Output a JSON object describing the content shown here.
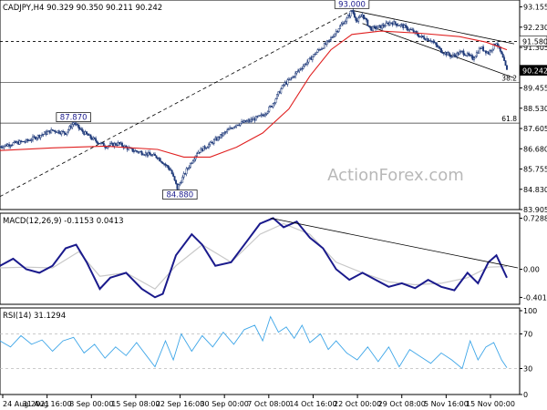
{
  "chart_data": [
    {
      "panel": "price",
      "type": "candlestick",
      "title": "CADJPY,H4  90.329 90.350 90.211 90.242",
      "watermark": "ActionForex.com",
      "last_price": "90.242",
      "y_ticks": [
        "93.155",
        "92.230",
        "91.305",
        "90.380",
        "89.455",
        "88.530",
        "87.605",
        "86.680",
        "85.755",
        "84.830",
        "83.905"
      ],
      "ylim": [
        83.905,
        93.47
      ],
      "x_ticks": [
        "24 Aug 2021",
        "31 Aug 16:00",
        "8 Sep 00:00",
        "15 Sep 08:00",
        "22 Sep 16:00",
        "30 Sep 00:00",
        "7 Oct 08:00",
        "14 Oct 16:00",
        "22 Oct 00:00",
        "29 Oct 08:00",
        "5 Nov 16:00",
        "15 Nov 00:00"
      ],
      "labels": {
        "high": "93.000",
        "left_high": "87.870",
        "low": "84.880",
        "resistance": "91.580"
      },
      "fib_levels": [
        {
          "label": "38.2",
          "value": 89.71
        },
        {
          "label": "61.8",
          "value": 87.85
        }
      ],
      "close_path": [
        [
          0,
          86.78
        ],
        [
          10,
          86.92
        ],
        [
          20,
          87.02
        ],
        [
          30,
          87.28
        ],
        [
          40,
          87.52
        ],
        [
          50,
          87.4
        ],
        [
          56,
          87.87
        ],
        [
          62,
          87.5
        ],
        [
          70,
          87.15
        ],
        [
          80,
          86.8
        ],
        [
          90,
          86.92
        ],
        [
          100,
          86.62
        ],
        [
          110,
          86.48
        ],
        [
          120,
          86.3
        ],
        [
          125,
          86.0
        ],
        [
          130,
          85.7
        ],
        [
          135,
          84.88
        ],
        [
          142,
          85.7
        ],
        [
          150,
          86.5
        ],
        [
          160,
          86.9
        ],
        [
          170,
          87.35
        ],
        [
          180,
          87.8
        ],
        [
          190,
          87.95
        ],
        [
          200,
          88.2
        ],
        [
          207,
          88.65
        ],
        [
          212,
          89.2
        ],
        [
          216,
          89.6
        ],
        [
          222,
          89.9
        ],
        [
          228,
          90.3
        ],
        [
          235,
          90.7
        ],
        [
          242,
          91.15
        ],
        [
          250,
          91.55
        ],
        [
          258,
          92.2
        ],
        [
          264,
          92.6
        ],
        [
          268,
          93.0
        ],
        [
          272,
          92.5
        ],
        [
          276,
          92.8
        ],
        [
          282,
          92.15
        ],
        [
          290,
          92.25
        ],
        [
          298,
          92.45
        ],
        [
          306,
          92.3
        ],
        [
          314,
          92.05
        ],
        [
          320,
          91.8
        ],
        [
          328,
          91.65
        ],
        [
          336,
          91.15
        ],
        [
          344,
          90.9
        ],
        [
          352,
          91.1
        ],
        [
          360,
          90.8
        ],
        [
          366,
          91.3
        ],
        [
          372,
          91.05
        ],
        [
          378,
          91.55
        ],
        [
          383,
          90.8
        ],
        [
          386,
          90.24
        ]
      ],
      "ma_path": [
        [
          0,
          86.6
        ],
        [
          40,
          86.72
        ],
        [
          80,
          86.8
        ],
        [
          120,
          86.65
        ],
        [
          140,
          86.3
        ],
        [
          160,
          86.3
        ],
        [
          180,
          86.75
        ],
        [
          200,
          87.4
        ],
        [
          220,
          88.5
        ],
        [
          236,
          90.0
        ],
        [
          252,
          91.2
        ],
        [
          268,
          91.9
        ],
        [
          290,
          92.05
        ],
        [
          320,
          91.95
        ],
        [
          350,
          91.8
        ],
        [
          370,
          91.55
        ],
        [
          386,
          91.2
        ]
      ],
      "overlays": {
        "rising_trendline": [
          [
            0,
            84.5
          ],
          [
            268,
            93.0
          ]
        ],
        "channel_upper": [
          [
            268,
            93.0
          ],
          [
            386,
            91.55
          ]
        ],
        "channel_lower": [
          [
            276,
            92.4
          ],
          [
            386,
            90.0
          ]
        ],
        "resistance_line": 91.58
      }
    },
    {
      "panel": "macd",
      "type": "line",
      "title": "MACD(12,26,9) -0.1153 0.0413",
      "y_ticks": [
        "0.7288",
        "0.00",
        "-0.4015"
      ],
      "ylim": [
        -0.5,
        0.8
      ],
      "macd_path": [
        [
          0,
          0.05
        ],
        [
          10,
          0.15
        ],
        [
          20,
          0.0
        ],
        [
          30,
          -0.05
        ],
        [
          40,
          0.05
        ],
        [
          50,
          0.3
        ],
        [
          58,
          0.35
        ],
        [
          66,
          0.1
        ],
        [
          76,
          -0.28
        ],
        [
          84,
          -0.12
        ],
        [
          96,
          -0.05
        ],
        [
          108,
          -0.28
        ],
        [
          118,
          -0.4
        ],
        [
          124,
          -0.35
        ],
        [
          134,
          0.2
        ],
        [
          146,
          0.5
        ],
        [
          154,
          0.35
        ],
        [
          164,
          0.05
        ],
        [
          176,
          0.1
        ],
        [
          188,
          0.4
        ],
        [
          198,
          0.65
        ],
        [
          208,
          0.73
        ],
        [
          216,
          0.6
        ],
        [
          226,
          0.68
        ],
        [
          236,
          0.45
        ],
        [
          246,
          0.3
        ],
        [
          256,
          0.0
        ],
        [
          266,
          -0.15
        ],
        [
          276,
          -0.05
        ],
        [
          286,
          -0.15
        ],
        [
          296,
          -0.25
        ],
        [
          306,
          -0.2
        ],
        [
          316,
          -0.27
        ],
        [
          326,
          -0.15
        ],
        [
          336,
          -0.25
        ],
        [
          346,
          -0.3
        ],
        [
          356,
          -0.05
        ],
        [
          364,
          -0.2
        ],
        [
          372,
          0.1
        ],
        [
          378,
          0.2
        ],
        [
          386,
          -0.12
        ]
      ],
      "signal_path": [
        [
          0,
          0.02
        ],
        [
          20,
          0.03
        ],
        [
          40,
          0.02
        ],
        [
          60,
          0.25
        ],
        [
          76,
          -0.1
        ],
        [
          96,
          -0.05
        ],
        [
          118,
          -0.28
        ],
        [
          134,
          0.05
        ],
        [
          154,
          0.35
        ],
        [
          176,
          0.1
        ],
        [
          198,
          0.5
        ],
        [
          216,
          0.65
        ],
        [
          236,
          0.5
        ],
        [
          256,
          0.1
        ],
        [
          276,
          -0.05
        ],
        [
          296,
          -0.18
        ],
        [
          316,
          -0.22
        ],
        [
          336,
          -0.2
        ],
        [
          356,
          -0.12
        ],
        [
          372,
          0.03
        ],
        [
          386,
          0.04
        ]
      ],
      "trendline": [
        [
          206,
          0.73
        ],
        [
          386,
          0.02
        ]
      ]
    },
    {
      "panel": "rsi",
      "type": "line",
      "title": "RSI(14) 31.1294",
      "y_ticks": [
        "100",
        "70",
        "30",
        "0"
      ],
      "ylim": [
        0,
        100
      ],
      "rsi_path": [
        [
          0,
          62
        ],
        [
          8,
          55
        ],
        [
          16,
          68
        ],
        [
          24,
          58
        ],
        [
          32,
          63
        ],
        [
          40,
          50
        ],
        [
          48,
          62
        ],
        [
          56,
          66
        ],
        [
          64,
          48
        ],
        [
          72,
          58
        ],
        [
          80,
          42
        ],
        [
          88,
          55
        ],
        [
          96,
          45
        ],
        [
          104,
          60
        ],
        [
          112,
          44
        ],
        [
          118,
          32
        ],
        [
          126,
          62
        ],
        [
          132,
          40
        ],
        [
          138,
          70
        ],
        [
          146,
          50
        ],
        [
          154,
          68
        ],
        [
          162,
          55
        ],
        [
          170,
          72
        ],
        [
          178,
          58
        ],
        [
          186,
          75
        ],
        [
          194,
          80
        ],
        [
          200,
          62
        ],
        [
          206,
          90
        ],
        [
          212,
          72
        ],
        [
          218,
          78
        ],
        [
          224,
          65
        ],
        [
          230,
          80
        ],
        [
          236,
          60
        ],
        [
          244,
          70
        ],
        [
          250,
          52
        ],
        [
          256,
          62
        ],
        [
          264,
          48
        ],
        [
          272,
          40
        ],
        [
          280,
          55
        ],
        [
          288,
          38
        ],
        [
          296,
          55
        ],
        [
          304,
          32
        ],
        [
          312,
          52
        ],
        [
          320,
          44
        ],
        [
          328,
          36
        ],
        [
          336,
          48
        ],
        [
          344,
          40
        ],
        [
          352,
          30
        ],
        [
          358,
          62
        ],
        [
          364,
          40
        ],
        [
          370,
          55
        ],
        [
          376,
          60
        ],
        [
          382,
          40
        ],
        [
          386,
          31
        ]
      ]
    }
  ],
  "colors": {
    "price": "#1f3a7a",
    "moving_average": "#e02020",
    "macd": "#1a1a8c",
    "signal": "#c8c8c8",
    "rsi": "#3ea6e8",
    "grid": "#e6e6e6",
    "line": "#000000"
  }
}
